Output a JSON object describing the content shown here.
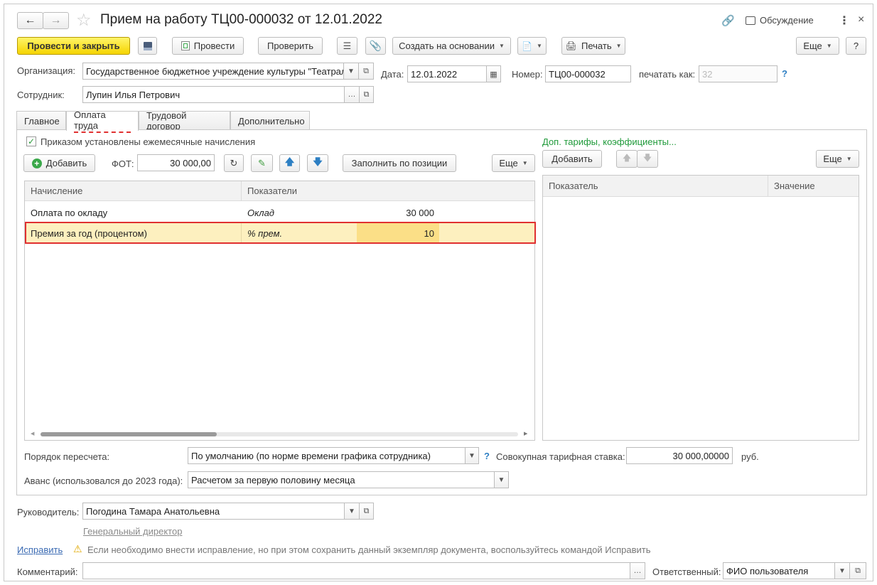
{
  "window": {
    "title": "Прием на работу ТЦ00-000032 от 12.01.2022",
    "discussion_label": "Обсуждение"
  },
  "toolbar": {
    "post_close": "Провести и закрыть",
    "post": "Провести",
    "check": "Проверить",
    "create_based": "Создать на основании",
    "print": "Печать",
    "more": "Еще",
    "help": "?"
  },
  "header": {
    "org_label": "Организация:",
    "org_value": "Государственное бюджетное учреждение культуры \"Театрал",
    "date_label": "Дата:",
    "date_value": "12.01.2022",
    "number_label": "Номер:",
    "number_value": "ТЦ00-000032",
    "print_as_label": "печатать как:",
    "print_as_placeholder": "32",
    "employee_label": "Сотрудник:",
    "employee_value": "Лупин Илья Петрович"
  },
  "tabs": [
    {
      "label": "Главное"
    },
    {
      "label": "Оплата труда"
    },
    {
      "label": "Трудовой договор"
    },
    {
      "label": "Дополнительно"
    }
  ],
  "pay": {
    "monthly_checkbox": "Приказом установлены ежемесячные начисления",
    "add": "Добавить",
    "fot_label": "ФОТ:",
    "fot_value": "30 000,00",
    "fill_by_position": "Заполнить по позиции",
    "more": "Еще",
    "columns": [
      "Начисление",
      "Показатели"
    ],
    "rows": [
      {
        "name": "Оплата по окладу",
        "indicator": "Оклад",
        "value": "30 000"
      },
      {
        "name": "Премия за год (процентом)",
        "indicator": "% прем.",
        "value": "10"
      }
    ]
  },
  "tariffs": {
    "link": "Доп. тарифы, коэффициенты...",
    "add": "Добавить",
    "more": "Еще",
    "columns": [
      "Показатель",
      "Значение"
    ]
  },
  "recalc": {
    "label": "Порядок пересчета:",
    "value": "По умолчанию (по норме времени графика сотрудника)",
    "total_rate_label": "Совокупная тарифная ставка:",
    "total_rate_value": "30 000,00000",
    "currency": "руб."
  },
  "advance": {
    "label": "Аванс (использовался до 2023 года):",
    "value": "Расчетом за первую половину месяца"
  },
  "footer": {
    "head_label": "Руководитель:",
    "head_value": "Погодина Тамара Анатольевна",
    "head_position": "Генеральный директор",
    "fix_link": "Исправить",
    "fix_hint": "Если необходимо внести исправление, но при этом сохранить данный экземпляр документа, воспользуйтесь командой Исправить",
    "comment_label": "Комментарий:",
    "responsible_label": "Ответственный:",
    "responsible_value": "ФИО пользователя"
  },
  "colors": {
    "primary_button": "#f5d400",
    "highlight_row": "#fdf0bf",
    "selection_border": "#e03030",
    "link": "#3b6bb3",
    "green_link": "#1f9a3a"
  }
}
